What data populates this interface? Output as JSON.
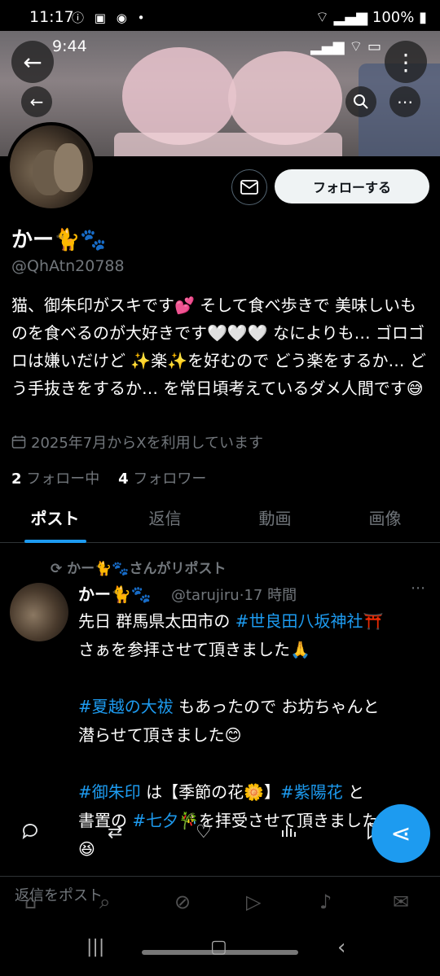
{
  "status_bar": {
    "time": "11:17",
    "battery": "100%",
    "inner_time": "9:44"
  },
  "profile": {
    "name": "かー🐈🐾",
    "handle": "@QhAtn20788",
    "bio": "猫、御朱印がスキです💕 そして食べ歩きで 美味しいものを食べるのが大好きです🤍🤍🤍 なによりも… ゴロゴロは嫌いだけど ✨楽✨を好むので どう楽をするか… どう手抜きをするか… を常日頃考えているダメ人間です😅",
    "joined": "2025年7月からXを利用しています",
    "following_count": "2",
    "following_label": "フォロー中",
    "followers_count": "4",
    "followers_label": "フォロワー",
    "follow_button": "フォローする"
  },
  "tabs": [
    {
      "label": "ポスト",
      "active": true
    },
    {
      "label": "返信",
      "active": false
    },
    {
      "label": "動画",
      "active": false
    },
    {
      "label": "画像",
      "active": false
    }
  ],
  "tweet": {
    "repost_label": "かー🐈🐾さんがリポスト",
    "author_name": "かー🐈🐾",
    "author_handle": "@tarujiru",
    "time": "17 時間",
    "line1_pre": "先日 群馬県太田市の ",
    "line1_tag": "#世良田八坂神社",
    "line1_post": "⛩️",
    "line2": "さぁを参拝させて頂きました🙏",
    "line3_tag": "#夏越の大祓",
    "line3_post": " もあったので お坊ちゃんと",
    "line4": "潜らせて頂きました😊",
    "line5_tag": "#御朱印",
    "line5_mid": " は【季節の花🌼】",
    "line5_tag2": "#紫陽花",
    "line5_post": " と",
    "line6_pre": "書置の ",
    "line6_tag": "#七夕",
    "line6_post": "🎋を拝受させて頂きました",
    "line7": "😆"
  },
  "reply_placeholder": "返信をポスト",
  "colors": {
    "accent": "#1d9bf0",
    "background": "#000000",
    "secondary_text": "#71767b"
  }
}
